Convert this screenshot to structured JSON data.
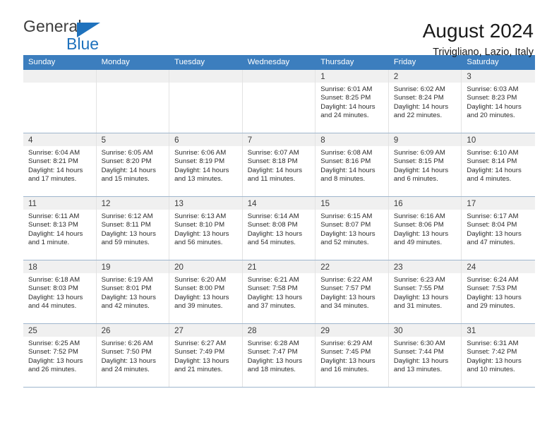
{
  "brand": {
    "name_top": "General",
    "name_bottom": "Blue",
    "logo_color": "#1f72bd"
  },
  "header": {
    "title": "August 2024",
    "subtitle": "Trivigliano, Lazio, Italy"
  },
  "theme": {
    "header_row_bg": "#3c7ebe",
    "header_row_text": "#ffffff",
    "day_number_strip_bg": "#f0f0f0",
    "row_divider": "#9fb6cd"
  },
  "weekdays": [
    "Sunday",
    "Monday",
    "Tuesday",
    "Wednesday",
    "Thursday",
    "Friday",
    "Saturday"
  ],
  "weeks": [
    [
      {
        "day": "",
        "empty": true
      },
      {
        "day": "",
        "empty": true
      },
      {
        "day": "",
        "empty": true
      },
      {
        "day": "",
        "empty": true
      },
      {
        "day": "1",
        "sunrise": "Sunrise: 6:01 AM",
        "sunset": "Sunset: 8:25 PM",
        "daylight1": "Daylight: 14 hours",
        "daylight2": "and 24 minutes."
      },
      {
        "day": "2",
        "sunrise": "Sunrise: 6:02 AM",
        "sunset": "Sunset: 8:24 PM",
        "daylight1": "Daylight: 14 hours",
        "daylight2": "and 22 minutes."
      },
      {
        "day": "3",
        "sunrise": "Sunrise: 6:03 AM",
        "sunset": "Sunset: 8:23 PM",
        "daylight1": "Daylight: 14 hours",
        "daylight2": "and 20 minutes."
      }
    ],
    [
      {
        "day": "4",
        "sunrise": "Sunrise: 6:04 AM",
        "sunset": "Sunset: 8:21 PM",
        "daylight1": "Daylight: 14 hours",
        "daylight2": "and 17 minutes."
      },
      {
        "day": "5",
        "sunrise": "Sunrise: 6:05 AM",
        "sunset": "Sunset: 8:20 PM",
        "daylight1": "Daylight: 14 hours",
        "daylight2": "and 15 minutes."
      },
      {
        "day": "6",
        "sunrise": "Sunrise: 6:06 AM",
        "sunset": "Sunset: 8:19 PM",
        "daylight1": "Daylight: 14 hours",
        "daylight2": "and 13 minutes."
      },
      {
        "day": "7",
        "sunrise": "Sunrise: 6:07 AM",
        "sunset": "Sunset: 8:18 PM",
        "daylight1": "Daylight: 14 hours",
        "daylight2": "and 11 minutes."
      },
      {
        "day": "8",
        "sunrise": "Sunrise: 6:08 AM",
        "sunset": "Sunset: 8:16 PM",
        "daylight1": "Daylight: 14 hours",
        "daylight2": "and 8 minutes."
      },
      {
        "day": "9",
        "sunrise": "Sunrise: 6:09 AM",
        "sunset": "Sunset: 8:15 PM",
        "daylight1": "Daylight: 14 hours",
        "daylight2": "and 6 minutes."
      },
      {
        "day": "10",
        "sunrise": "Sunrise: 6:10 AM",
        "sunset": "Sunset: 8:14 PM",
        "daylight1": "Daylight: 14 hours",
        "daylight2": "and 4 minutes."
      }
    ],
    [
      {
        "day": "11",
        "sunrise": "Sunrise: 6:11 AM",
        "sunset": "Sunset: 8:13 PM",
        "daylight1": "Daylight: 14 hours",
        "daylight2": "and 1 minute."
      },
      {
        "day": "12",
        "sunrise": "Sunrise: 6:12 AM",
        "sunset": "Sunset: 8:11 PM",
        "daylight1": "Daylight: 13 hours",
        "daylight2": "and 59 minutes."
      },
      {
        "day": "13",
        "sunrise": "Sunrise: 6:13 AM",
        "sunset": "Sunset: 8:10 PM",
        "daylight1": "Daylight: 13 hours",
        "daylight2": "and 56 minutes."
      },
      {
        "day": "14",
        "sunrise": "Sunrise: 6:14 AM",
        "sunset": "Sunset: 8:08 PM",
        "daylight1": "Daylight: 13 hours",
        "daylight2": "and 54 minutes."
      },
      {
        "day": "15",
        "sunrise": "Sunrise: 6:15 AM",
        "sunset": "Sunset: 8:07 PM",
        "daylight1": "Daylight: 13 hours",
        "daylight2": "and 52 minutes."
      },
      {
        "day": "16",
        "sunrise": "Sunrise: 6:16 AM",
        "sunset": "Sunset: 8:06 PM",
        "daylight1": "Daylight: 13 hours",
        "daylight2": "and 49 minutes."
      },
      {
        "day": "17",
        "sunrise": "Sunrise: 6:17 AM",
        "sunset": "Sunset: 8:04 PM",
        "daylight1": "Daylight: 13 hours",
        "daylight2": "and 47 minutes."
      }
    ],
    [
      {
        "day": "18",
        "sunrise": "Sunrise: 6:18 AM",
        "sunset": "Sunset: 8:03 PM",
        "daylight1": "Daylight: 13 hours",
        "daylight2": "and 44 minutes."
      },
      {
        "day": "19",
        "sunrise": "Sunrise: 6:19 AM",
        "sunset": "Sunset: 8:01 PM",
        "daylight1": "Daylight: 13 hours",
        "daylight2": "and 42 minutes."
      },
      {
        "day": "20",
        "sunrise": "Sunrise: 6:20 AM",
        "sunset": "Sunset: 8:00 PM",
        "daylight1": "Daylight: 13 hours",
        "daylight2": "and 39 minutes."
      },
      {
        "day": "21",
        "sunrise": "Sunrise: 6:21 AM",
        "sunset": "Sunset: 7:58 PM",
        "daylight1": "Daylight: 13 hours",
        "daylight2": "and 37 minutes."
      },
      {
        "day": "22",
        "sunrise": "Sunrise: 6:22 AM",
        "sunset": "Sunset: 7:57 PM",
        "daylight1": "Daylight: 13 hours",
        "daylight2": "and 34 minutes."
      },
      {
        "day": "23",
        "sunrise": "Sunrise: 6:23 AM",
        "sunset": "Sunset: 7:55 PM",
        "daylight1": "Daylight: 13 hours",
        "daylight2": "and 31 minutes."
      },
      {
        "day": "24",
        "sunrise": "Sunrise: 6:24 AM",
        "sunset": "Sunset: 7:53 PM",
        "daylight1": "Daylight: 13 hours",
        "daylight2": "and 29 minutes."
      }
    ],
    [
      {
        "day": "25",
        "sunrise": "Sunrise: 6:25 AM",
        "sunset": "Sunset: 7:52 PM",
        "daylight1": "Daylight: 13 hours",
        "daylight2": "and 26 minutes."
      },
      {
        "day": "26",
        "sunrise": "Sunrise: 6:26 AM",
        "sunset": "Sunset: 7:50 PM",
        "daylight1": "Daylight: 13 hours",
        "daylight2": "and 24 minutes."
      },
      {
        "day": "27",
        "sunrise": "Sunrise: 6:27 AM",
        "sunset": "Sunset: 7:49 PM",
        "daylight1": "Daylight: 13 hours",
        "daylight2": "and 21 minutes."
      },
      {
        "day": "28",
        "sunrise": "Sunrise: 6:28 AM",
        "sunset": "Sunset: 7:47 PM",
        "daylight1": "Daylight: 13 hours",
        "daylight2": "and 18 minutes."
      },
      {
        "day": "29",
        "sunrise": "Sunrise: 6:29 AM",
        "sunset": "Sunset: 7:45 PM",
        "daylight1": "Daylight: 13 hours",
        "daylight2": "and 16 minutes."
      },
      {
        "day": "30",
        "sunrise": "Sunrise: 6:30 AM",
        "sunset": "Sunset: 7:44 PM",
        "daylight1": "Daylight: 13 hours",
        "daylight2": "and 13 minutes."
      },
      {
        "day": "31",
        "sunrise": "Sunrise: 6:31 AM",
        "sunset": "Sunset: 7:42 PM",
        "daylight1": "Daylight: 13 hours",
        "daylight2": "and 10 minutes."
      }
    ]
  ]
}
